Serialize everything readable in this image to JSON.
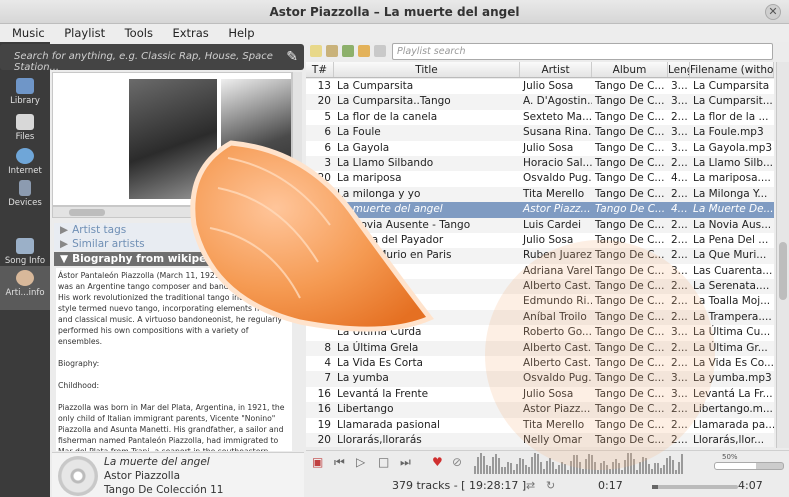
{
  "window": {
    "title": "Astor Piazzolla – La muerte del angel"
  },
  "menu": [
    "Music",
    "Playlist",
    "Tools",
    "Extras",
    "Help"
  ],
  "search": {
    "placeholder": "Search for anything, e.g. Classic Rap, House, Space Station..."
  },
  "nav": [
    {
      "label": "Library",
      "icon": "library-icon"
    },
    {
      "label": "Files",
      "icon": "files-icon"
    },
    {
      "label": "Internet",
      "icon": "internet-icon"
    },
    {
      "label": "Devices",
      "icon": "devices-icon"
    },
    {
      "label": "Song Info",
      "icon": "song-info-icon"
    },
    {
      "label": "Arti...info",
      "icon": "artist-info-icon"
    }
  ],
  "sections": {
    "tags": "Artist tags",
    "similar": "Similar artists",
    "bio": "Biography from wikipedia"
  },
  "bio": {
    "p1": "Ástor Pantaleón Piazzolla (March 11, 1921 – July 4, 1992) was an Argentine tango composer and bandoneón player. His work revolutionized the traditional tango into a new style termed nuevo tango, incorporating elements from jazz and classical music. A virtuoso bandoneonist, he regularly performed his own compositions with a variety of ensembles.",
    "p2": "Biography:",
    "p3": "Childhood:",
    "p4": "Piazzolla was born in Mar del Plata, Argentina, in 1921, the only child of Italian immigrant parents, Vicente \"Nonino\" Piazzolla and Asunta Manetti. His grandfather, a sailor and fisherman named Pantaleón Piazzolla, had immigrated to Mar del Plata from Trani, a seaport in the southeastern Italian region of Apulia, at the end of the 19th century. In 1925 Astor Piazzolla moved with his"
  },
  "now_playing": {
    "title": "La muerte del angel",
    "artist": "Astor Piazzolla",
    "album": "Tango De Colección 11"
  },
  "playlist": {
    "search_placeholder": "Playlist search",
    "columns": [
      "T#",
      "Title",
      "Artist",
      "Album",
      "Leng",
      "Filename (without p"
    ],
    "rows": [
      {
        "n": "13",
        "t": "La Cumparsita",
        "a": "Julio Sosa",
        "al": "Tango De C...",
        "l": "3...",
        "f": "La Cumparsita"
      },
      {
        "n": "20",
        "t": "La Cumparsita..Tango",
        "a": "A. D'Agostin...",
        "al": "Tango De C...",
        "l": "3...",
        "f": "La Cumparsit..."
      },
      {
        "n": "5",
        "t": "La flor de la canela",
        "a": "Sexteto Ma...",
        "al": "Tango De C...",
        "l": "2...",
        "f": "La flor de la ..."
      },
      {
        "n": "6",
        "t": "La Foule",
        "a": "Susana Rina...",
        "al": "Tango De C...",
        "l": "3...",
        "f": "La Foule.mp3"
      },
      {
        "n": "6",
        "t": "La Gayola",
        "a": "Julio Sosa",
        "al": "Tango De C...",
        "l": "3...",
        "f": "La Gayola.mp3"
      },
      {
        "n": "3",
        "t": "La Llamo Silbando",
        "a": "Horacio Sal...",
        "al": "Tango De C...",
        "l": "2...",
        "f": "La Llamo Silb..."
      },
      {
        "n": "20",
        "t": "La mariposa",
        "a": "Osvaldo Pug...",
        "al": "Tango De C...",
        "l": "4...",
        "f": "La mariposa...."
      },
      {
        "n": "12",
        "t": "La milonga y yo",
        "a": "Tita Merello",
        "al": "Tango De C...",
        "l": "2...",
        "f": "La Milonga Y..."
      },
      {
        "n": "",
        "t": "La muerte del angel",
        "a": "Astor Piazz...",
        "al": "Tango De C...",
        "l": "4...",
        "f": "La Muerte De..."
      },
      {
        "n": "10",
        "t": "La Novia Ausente - Tango",
        "a": "Luis Cardei",
        "al": "Tango De C...",
        "l": "2...",
        "f": "La Novia Aus..."
      },
      {
        "n": "",
        "t": "La Pena del Payador",
        "a": "Julio Sosa",
        "al": "Tango De C...",
        "l": "2...",
        "f": "La Pena Del ..."
      },
      {
        "n": "",
        "t": "La Que Murio en Paris",
        "a": "Ruben Juarez",
        "al": "Tango De C...",
        "l": "2...",
        "f": "La Que Muri..."
      },
      {
        "n": "",
        "t": "",
        "a": "Adriana Varela",
        "al": "Tango De C...",
        "l": "3...",
        "f": "Las Cuarenta..."
      },
      {
        "n": "",
        "t": "",
        "a": "Alberto Cast...",
        "al": "Tango De C...",
        "l": "2...",
        "f": "La Serenata...."
      },
      {
        "n": "",
        "t": "",
        "a": "Edmundo Ri...",
        "al": "Tango De C...",
        "l": "2...",
        "f": "La Toalla Moj..."
      },
      {
        "n": "",
        "t": "",
        "a": "Aníbal Troilo",
        "al": "Tango De C...",
        "l": "2...",
        "f": "La Trampera...."
      },
      {
        "n": "",
        "t": "La Última Curda",
        "a": "Roberto Go...",
        "al": "Tango De C...",
        "l": "3...",
        "f": "La Última Cu..."
      },
      {
        "n": "8",
        "t": "La Última Grela",
        "a": "Alberto Cast...",
        "al": "Tango De C...",
        "l": "2...",
        "f": "La Última Gr..."
      },
      {
        "n": "4",
        "t": "La Vida Es Corta",
        "a": "Alberto Cast...",
        "al": "Tango De C...",
        "l": "2...",
        "f": "La Vida Es Co..."
      },
      {
        "n": "7",
        "t": "La yumba",
        "a": "Osvaldo Pug...",
        "al": "Tango De C...",
        "l": "3...",
        "f": "La yumba.mp3"
      },
      {
        "n": "16",
        "t": "Levantá la Frente",
        "a": "Julio Sosa",
        "al": "Tango De C...",
        "l": "3...",
        "f": "Levantá La Fr..."
      },
      {
        "n": "16",
        "t": "Libertango",
        "a": "Astor Piazz...",
        "al": "Tango De C...",
        "l": "2...",
        "f": "Libertango.m..."
      },
      {
        "n": "19",
        "t": "Llamarada pasional",
        "a": "Tita Merello",
        "al": "Tango De C...",
        "l": "2...",
        "f": "Llamarada pa..."
      },
      {
        "n": "20",
        "t": "Llorarás,llorarás",
        "a": "Nelly Omar",
        "al": "Tango De C...",
        "l": "2...",
        "f": "Llorarás,llor..."
      }
    ],
    "current_index": 8
  },
  "status": {
    "tracks": "379 tracks - [ 19:28:17 ]",
    "elapsed": "0:17",
    "total": "4:07",
    "progress": 0.07
  },
  "volume": {
    "label": "50%",
    "level": 0.6
  },
  "colors": {
    "accent": "#7f9bc2",
    "sidebar": "#3b3b3b",
    "clementine": "#f08a3c"
  }
}
